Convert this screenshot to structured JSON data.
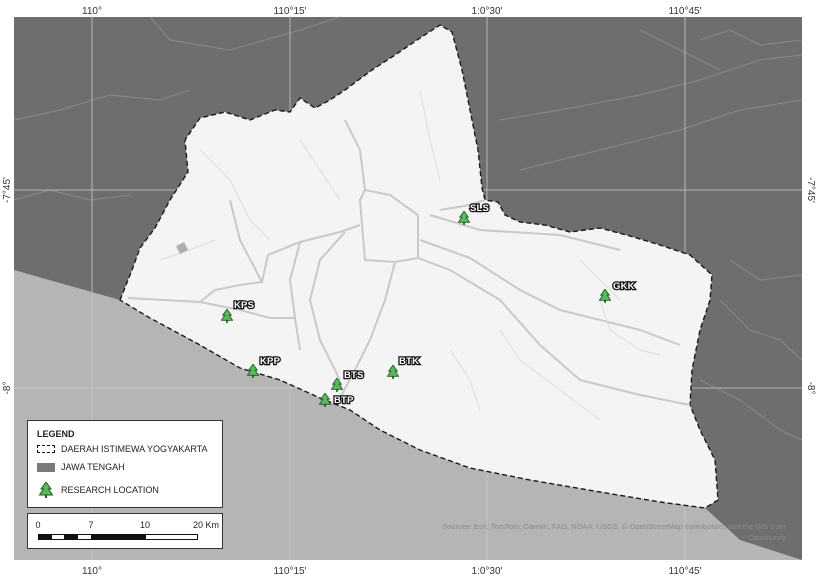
{
  "coordinates": {
    "top": [
      "110°",
      "110°15'",
      "1:0°30'",
      "110°45'"
    ],
    "bottom": [
      "110°",
      "110°15'",
      "1:0°30'",
      "110°45'"
    ],
    "left": [
      "-7°45'",
      "-8°"
    ],
    "right": [
      "-7°45'",
      "-8°"
    ]
  },
  "sites": [
    {
      "code": "SLS"
    },
    {
      "code": "GKK"
    },
    {
      "code": "KPS"
    },
    {
      "code": "KPP"
    },
    {
      "code": "BTK"
    },
    {
      "code": "BTS"
    },
    {
      "code": "BTP"
    }
  ],
  "legend": {
    "title": "LEGEND",
    "items": [
      {
        "label": "DAERAH ISTIMEWA YOGYAKARTA",
        "symbol": "dashed-boundary"
      },
      {
        "label": "JAWA TENGAH",
        "symbol": "gray-fill"
      },
      {
        "label": "RESEARCH LOCATION",
        "symbol": "tree-icon"
      }
    ]
  },
  "scalebar": {
    "ticks": [
      "0",
      "7",
      "10",
      "20 Km"
    ]
  },
  "attribution": "Sources: Esri, TomTom, Garmin, FAO, NOAA, USGS, © OpenStreetMap contributors, and the GIS User Community",
  "colors": {
    "region_fill": "#f4f4f4",
    "neighbor_land": "#6e6e6e",
    "sea": "#b5b5b5",
    "marker": "#5cb85c",
    "marker_outline": "#1c5a1c"
  }
}
